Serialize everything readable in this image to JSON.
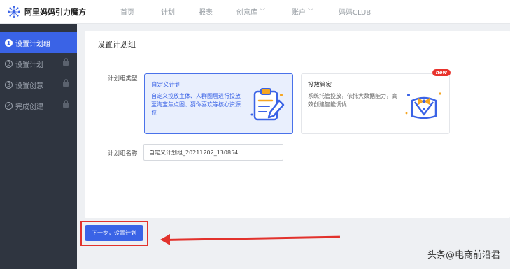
{
  "app": {
    "logo_text": "阿里妈妈引力魔方"
  },
  "nav": [
    {
      "label": "首页",
      "has_dropdown": false
    },
    {
      "label": "计划",
      "has_dropdown": false
    },
    {
      "label": "报表",
      "has_dropdown": false
    },
    {
      "label": "创意库",
      "has_dropdown": true
    },
    {
      "label": "账户",
      "has_dropdown": true
    },
    {
      "label": "妈妈CLUB",
      "has_dropdown": false
    }
  ],
  "sidebar": {
    "items": [
      {
        "num": "1",
        "label": "设置计划组",
        "active": true,
        "locked": false
      },
      {
        "num": "2",
        "label": "设置计划",
        "active": false,
        "locked": true
      },
      {
        "num": "3",
        "label": "设置创意",
        "active": false,
        "locked": true
      },
      {
        "num": "✓",
        "label": "完成创建",
        "active": false,
        "locked": true
      }
    ]
  },
  "main": {
    "title": "设置计划组",
    "type_label": "计划组类型",
    "options": [
      {
        "title": "自定义计划",
        "desc": "自定义投放主体、人群圈层进行投放至淘宝焦点图、猜你喜欢等核心资源位",
        "selected": true
      },
      {
        "title": "投放管家",
        "desc": "系统托管投放，依托大数据能力，高效创建智能调优",
        "badge": "new",
        "selected": false
      }
    ],
    "name_label": "计划组名称",
    "name_value": "自定义计划组_20211202_130854"
  },
  "next_button": "下一步，设置计划",
  "watermark": {
    "prefix": "头条",
    "text": "@电商前沿君"
  },
  "colors": {
    "primary": "#3a63e6",
    "sidebar": "#2f3540",
    "annotation": "#e2322c",
    "badge": "#e8322c"
  }
}
